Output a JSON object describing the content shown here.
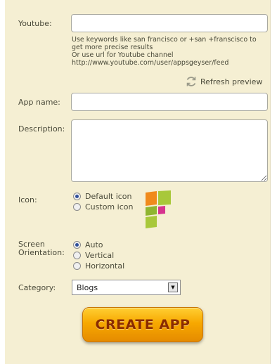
{
  "form": {
    "youtube": {
      "label": "Youtube:",
      "value": "",
      "hint_lines": [
        "Use keywords like san francisco or +san +franscisco to",
        "get more precise results",
        "Or use url for Youtube channel",
        "http://www.youtube.com/user/appsgeyser/feed"
      ]
    },
    "refresh_label": "Refresh preview",
    "app_name": {
      "label": "App name:",
      "value": ""
    },
    "description": {
      "label": "Description:",
      "value": ""
    },
    "icon": {
      "label": "Icon:",
      "options": [
        "Default icon",
        "Custom icon"
      ],
      "selected": "Default icon"
    },
    "orientation": {
      "label_line1": "Screen",
      "label_line2": "Orientation:",
      "options": [
        "Auto",
        "Vertical",
        "Horizontal"
      ],
      "selected": "Auto"
    },
    "category": {
      "label": "Category:",
      "value": "Blogs"
    },
    "create_label": "CREATE APP"
  },
  "colors": {
    "panel_bg": "#f5efd3",
    "button_top": "#ffcf33",
    "button_bottom": "#e58b00",
    "button_text": "#8a2b00"
  }
}
